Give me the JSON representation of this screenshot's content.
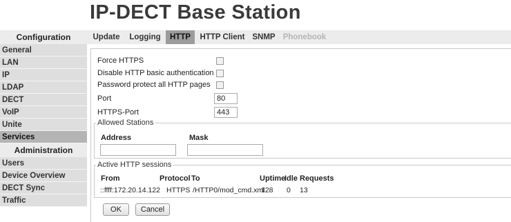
{
  "page": {
    "title": "IP-DECT Base Station"
  },
  "sidebar": {
    "configuration_header": "Configuration",
    "configuration_items": [
      "General",
      "LAN",
      "IP",
      "LDAP",
      "DECT",
      "VoIP",
      "Unite",
      "Services"
    ],
    "administration_header": "Administration",
    "administration_items": [
      "Users",
      "Device Overview",
      "DECT Sync",
      "Traffic"
    ],
    "active": "Services"
  },
  "tabs": [
    "Update",
    "Logging",
    "HTTP",
    "HTTP Client",
    "SNMP",
    "Phonebook"
  ],
  "active_tab": "HTTP",
  "disabled_tab": "Phonebook",
  "form": {
    "force_https_label": "Force HTTPS",
    "disable_basic_auth_label": "Disable HTTP basic authentication",
    "password_protect_label": "Password protect all HTTP pages",
    "port_label": "Port",
    "port_value": "80",
    "https_port_label": "HTTPS-Port",
    "https_port_value": "443"
  },
  "allowed_stations": {
    "legend": "Allowed Stations",
    "address_header": "Address",
    "mask_header": "Mask",
    "address_value": "",
    "mask_value": ""
  },
  "sessions": {
    "legend": "Active HTTP sessions",
    "headers": {
      "from": "From",
      "protocol": "Protocol",
      "to": "To",
      "uptime": "Uptime",
      "idle": "Idle",
      "requests": "Requests"
    },
    "rows": [
      {
        "from": "::ffff:172.20.14.122",
        "protocol": "HTTPS",
        "to": "/HTTP0/mod_cmd.xml",
        "uptime": "128",
        "idle": "0",
        "requests": "13"
      }
    ]
  },
  "buttons": {
    "ok": "OK",
    "cancel": "Cancel"
  }
}
